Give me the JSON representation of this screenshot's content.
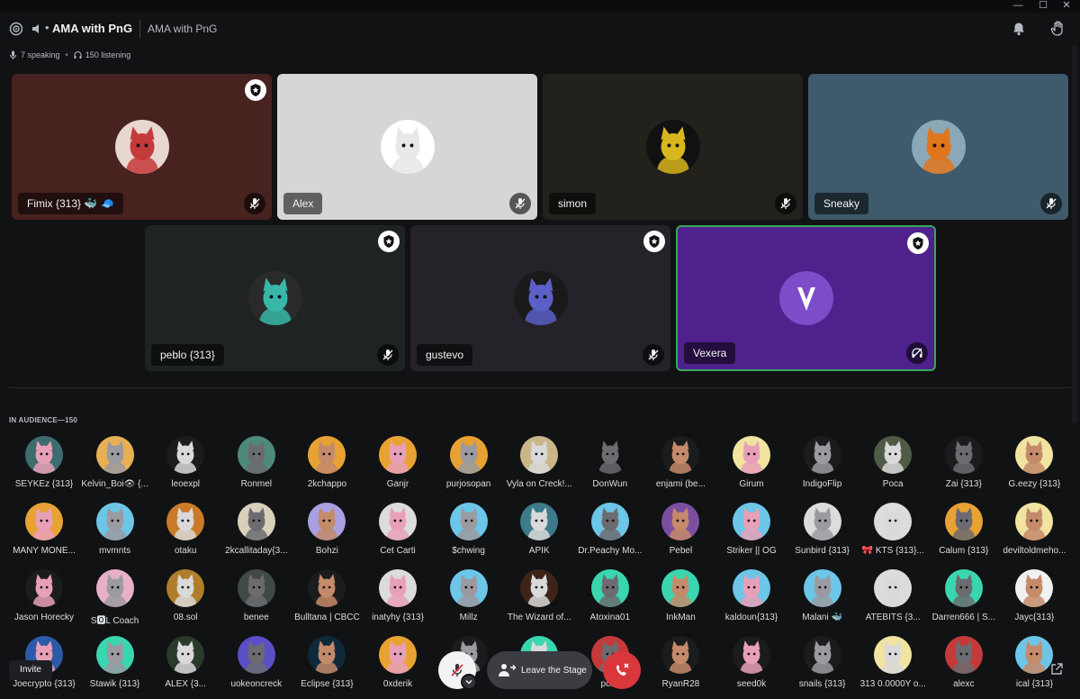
{
  "window": {
    "minimize": "—",
    "maximize": "☐",
    "close": "✕"
  },
  "header": {
    "title": "AMA with PnG",
    "separator": "•",
    "topic": "AMA with PnG",
    "speaking": "7 speaking",
    "listening": "150 listening",
    "stat_separator": "•"
  },
  "speakers": [
    {
      "name": "Fimix {313} 🐳 🧢",
      "bg": "#47221f",
      "avatar_color": "#c43a3a",
      "avatar_bg": "#e8d7d0",
      "moderator": true,
      "muted": true,
      "active": false
    },
    {
      "name": "Alex",
      "bg": "#d6d6d6",
      "avatar_color": "#e8e8e8",
      "avatar_bg": "#ffffff",
      "moderator": false,
      "muted": true,
      "active": false
    },
    {
      "name": "simon",
      "bg": "#23211c",
      "avatar_color": "#d9b61e",
      "avatar_bg": "#111111",
      "moderator": false,
      "muted": true,
      "active": false
    },
    {
      "name": "Sneaky",
      "bg": "#3f5a6b",
      "avatar_color": "#e0761b",
      "avatar_bg": "#8aa8b8",
      "moderator": false,
      "muted": true,
      "active": false
    },
    {
      "name": "peblo {313}",
      "bg": "#1f2422",
      "avatar_color": "#38b6a8",
      "avatar_bg": "#2a2a2a",
      "moderator": true,
      "muted": true,
      "active": false
    },
    {
      "name": "gustevo",
      "bg": "#252229",
      "avatar_color": "#5b5fc7",
      "avatar_bg": "#1a1a1a",
      "moderator": true,
      "muted": true,
      "active": false
    },
    {
      "name": "Vexera",
      "bg": "#4e218c",
      "avatar_color": "#7b4dc9",
      "avatar_bg": "#6a35b5",
      "moderator": true,
      "muted": false,
      "active": true
    }
  ],
  "audience": {
    "header": "IN AUDIENCE—150",
    "rows": [
      [
        {
          "name": "SEYKEz {313}",
          "bg": "#3d6c6f"
        },
        {
          "name": "Kelvin_Boi👁 {...",
          "bg": "#e8b054"
        },
        {
          "name": "leoexpl",
          "bg": "#1b1c1e"
        },
        {
          "name": "Ronmel",
          "bg": "#4d8a7a"
        },
        {
          "name": "2kchappo",
          "bg": "#e8a233"
        },
        {
          "name": "Ganjr",
          "bg": "#e8a233"
        },
        {
          "name": "purjosopan",
          "bg": "#e8a233"
        },
        {
          "name": "Vyla on Creck!...",
          "bg": "#c9b78a"
        },
        {
          "name": "DonWun",
          "bg": "#111111"
        },
        {
          "name": "enjami (be...",
          "bg": "#1b1c1e"
        },
        {
          "name": "Girum",
          "bg": "#f0e4a0"
        },
        {
          "name": "IndigoFlip",
          "bg": "#1b1c1e"
        },
        {
          "name": "Poca",
          "bg": "#4f5a47"
        },
        {
          "name": "Zai {313}",
          "bg": "#1b1c1e"
        },
        {
          "name": "G.eezy {313}",
          "bg": "#f0e4a0"
        }
      ],
      [
        {
          "name": "MANY MONE...",
          "bg": "#e8a233"
        },
        {
          "name": "mvmnts",
          "bg": "#6cc6e8"
        },
        {
          "name": "otaku",
          "bg": "#c97b2a"
        },
        {
          "name": "2kcallitaday{3...",
          "bg": "#d9d0bb"
        },
        {
          "name": "Bohzi",
          "bg": "#a8a0e0"
        },
        {
          "name": "Cet Carti",
          "bg": "#dcdcdc"
        },
        {
          "name": "$chwing",
          "bg": "#6cc6e8"
        },
        {
          "name": "APIK",
          "bg": "#3d7a8a"
        },
        {
          "name": "Dr.Peachy Mo...",
          "bg": "#6cc6e8"
        },
        {
          "name": "Pebel",
          "bg": "#7a4fa0"
        },
        {
          "name": "Striker || OG",
          "bg": "#6cc6e8"
        },
        {
          "name": "Sunbird {313}",
          "bg": "#dcdcdc"
        },
        {
          "name": "🎀 KTS {313}...",
          "bg": "#dcdcdc"
        },
        {
          "name": "Calum {313}",
          "bg": "#e8a233"
        },
        {
          "name": "deviltoldmeho...",
          "bg": "#f0e4a0"
        }
      ],
      [
        {
          "name": "Jason Horecky",
          "bg": "#1b1c1e"
        },
        {
          "name": "S🅾L Coach",
          "bg": "#e8b0c8"
        },
        {
          "name": "08.sol",
          "bg": "#b07d2a"
        },
        {
          "name": "benee",
          "bg": "#3f4a46"
        },
        {
          "name": "Bulltana | CBCC",
          "bg": "#1b1c1e"
        },
        {
          "name": "inatyhy {313}",
          "bg": "#dcdcdc"
        },
        {
          "name": "Millz",
          "bg": "#6cc6e8"
        },
        {
          "name": "The Wizard of...",
          "bg": "#3d2418"
        },
        {
          "name": "Atoxina01",
          "bg": "#3ad6b0"
        },
        {
          "name": "InkMan",
          "bg": "#3ad6b0"
        },
        {
          "name": "kaldoun{313}",
          "bg": "#6cc6e8"
        },
        {
          "name": "Malani 🐳",
          "bg": "#6cc6e8"
        },
        {
          "name": "ATEBITS {3...",
          "bg": "#dcdcdc"
        },
        {
          "name": "Darren666 | S...",
          "bg": "#3ad6b0"
        },
        {
          "name": "Jayc{313}",
          "bg": "#f0f0f0"
        }
      ],
      [
        {
          "name": "Joecrypto {313}",
          "bg": "#2a5aa8"
        },
        {
          "name": "Stawik {313}",
          "bg": "#3ad6b0"
        },
        {
          "name": "ALEX {3...",
          "bg": "#2a3a2a"
        },
        {
          "name": "uokeoncreck",
          "bg": "#5b4fc7"
        },
        {
          "name": "Eclipse {313}",
          "bg": "#0e2a3a"
        },
        {
          "name": "0xderik",
          "bg": "#e8a233"
        },
        {
          "name": "",
          "bg": "#1b1c1e"
        },
        {
          "name": "",
          "bg": "#3ad6b0"
        },
        {
          "name": "pclst",
          "bg": "#c43a3a"
        },
        {
          "name": "RyanR28",
          "bg": "#1b1c1e"
        },
        {
          "name": "seed0k",
          "bg": "#1b1c1e"
        },
        {
          "name": "snails {313}",
          "bg": "#1b1c1e"
        },
        {
          "name": "313 0.0000Y o...",
          "bg": "#f0e4a0"
        },
        {
          "name": "alexc",
          "bg": "#c43a3a"
        },
        {
          "name": "ical {313}",
          "bg": "#6cc6e8"
        }
      ]
    ]
  },
  "controls": {
    "invite": "Invite",
    "leave_stage": "Leave the Stage"
  },
  "colors": {
    "background": "#111214",
    "accent_green": "#3ba55c",
    "danger": "#da373c",
    "tag_purple": "#a970ff"
  }
}
